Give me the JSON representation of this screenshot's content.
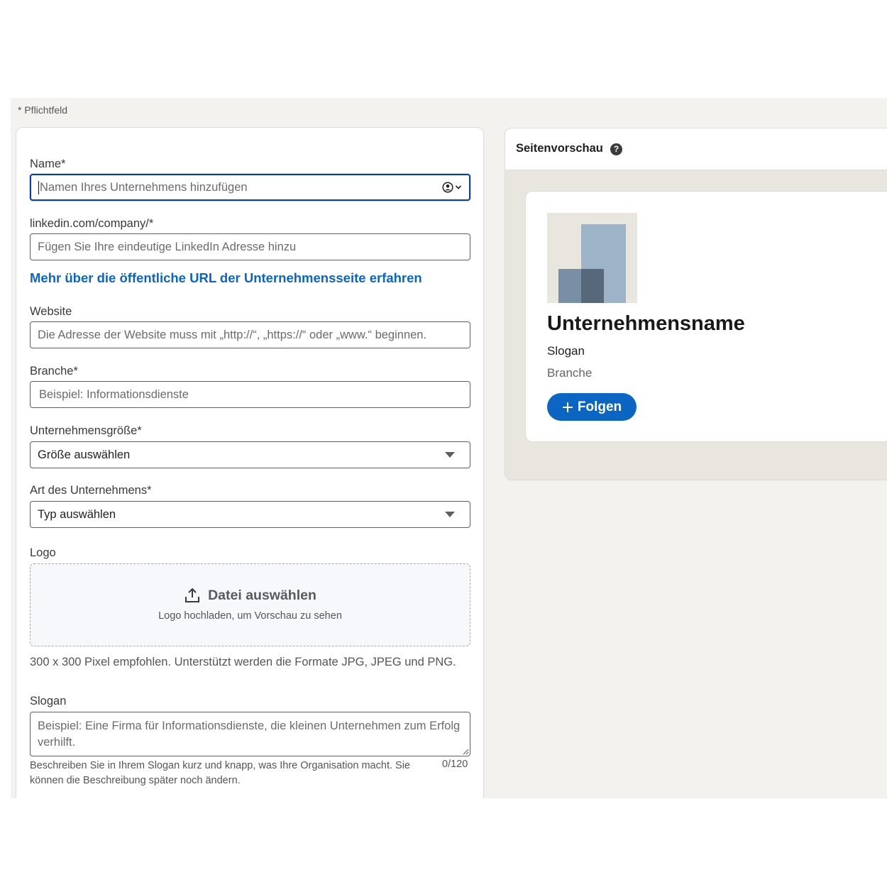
{
  "required_note": "* Pflichtfeld",
  "form": {
    "name": {
      "label": "Name*",
      "placeholder": "Namen Ihres Unternehmens hinzufügen"
    },
    "url": {
      "label": "linkedin.com/company/*",
      "placeholder": "Fügen Sie Ihre eindeutige LinkedIn Adresse hinzu"
    },
    "learn_more_link": "Mehr über die öffentliche URL der Unternehmensseite erfahren",
    "website": {
      "label": "Website",
      "placeholder": "Die Adresse der Website muss mit „http://“, „https://“ oder „www.“ beginnen."
    },
    "industry": {
      "label": "Branche*",
      "placeholder": "Beispiel: Informationsdienste"
    },
    "size": {
      "label": "Unternehmensgröße*",
      "value": "Größe auswählen"
    },
    "type": {
      "label": "Art des Unternehmens*",
      "value": "Typ auswählen"
    },
    "logo": {
      "label": "Logo",
      "button": "Datei auswählen",
      "hint": "Logo hochladen, um Vorschau zu sehen",
      "help": "300 x 300 Pixel empfohlen. Unterstützt werden die Formate JPG, JPEG und PNG."
    },
    "slogan": {
      "label": "Slogan",
      "placeholder": "Beispiel: Eine Firma für Informationsdienste, die kleinen Unternehmen zum Erfolg verhilft.",
      "help": "Beschreiben Sie in Ihrem Slogan kurz und knapp, was Ihre Organisation macht. Sie können die Beschreibung später noch ändern.",
      "counter": "0/120"
    }
  },
  "preview": {
    "title": "Seitenvorschau",
    "help_icon": "question-circle-icon",
    "company_name": "Unternehmensname",
    "slogan": "Slogan",
    "industry": "Branche",
    "follow_label": "Folgen"
  },
  "colors": {
    "accent": "#0a66c2",
    "focus_border": "#0a3e9c",
    "page_bg": "#f4f2ee"
  }
}
